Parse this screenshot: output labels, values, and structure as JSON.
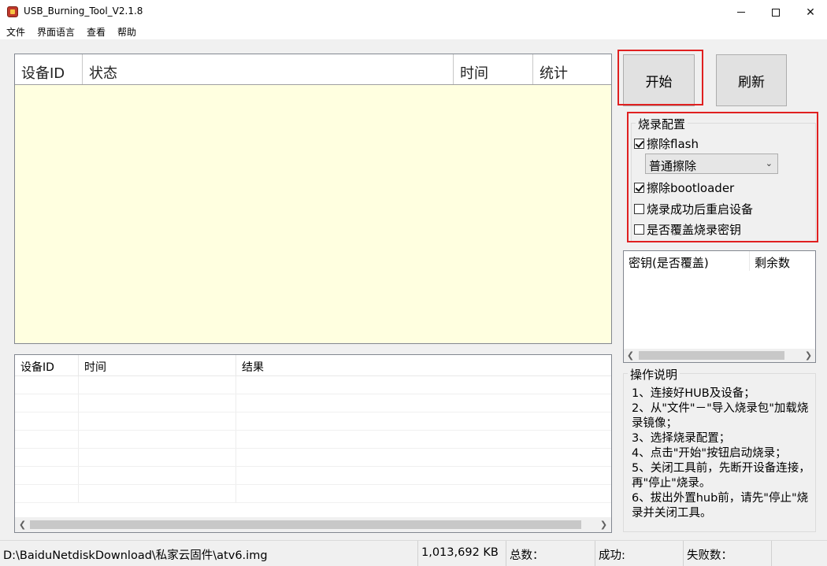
{
  "window": {
    "title": "USB_Burning_Tool_V2.1.8",
    "minimize": "—",
    "maximize": "☐",
    "close": "✕"
  },
  "menu": [
    "文件",
    "界面语言",
    "查看",
    "帮助"
  ],
  "device_table": {
    "columns": [
      "设备ID",
      "状态",
      "时间",
      "统计"
    ]
  },
  "result_table": {
    "columns": [
      "设备ID",
      "时间",
      "结果"
    ]
  },
  "buttons": {
    "start": "开始",
    "refresh": "刷新"
  },
  "config": {
    "title": "烧录配置",
    "erase_flash": "擦除flash",
    "erase_mode": "普通擦除",
    "erase_bootloader": "擦除bootloader",
    "reboot_after": "烧录成功后重启设备",
    "overwrite_key": "是否覆盖烧录密钥",
    "checked": {
      "erase_flash": true,
      "erase_bootloader": true,
      "reboot_after": false,
      "overwrite_key": false
    }
  },
  "key_list": {
    "columns": [
      "密钥(是否覆盖)",
      "剩余数"
    ]
  },
  "instructions": {
    "title": "操作说明",
    "text": "1、连接好HUB及设备；\n2、从\"文件\"－\"导入烧录包\"加载烧录镜像；\n3、选择烧录配置；\n4、点击\"开始\"按钮启动烧录；\n5、关闭工具前，先断开设备连接，再\"停止\"烧录。\n6、拔出外置hub前，请先\"停止\"烧录并关闭工具。"
  },
  "status_bar": {
    "path": "D:\\BaiduNetdiskDownload\\私家云固件\\atv6.img",
    "size": "1,013,692 KB",
    "total": "总数：",
    "success": "成功:",
    "fail": "失败数："
  },
  "colors": {
    "device_table_bg": "#ffffe0",
    "highlight": "#e02020"
  }
}
